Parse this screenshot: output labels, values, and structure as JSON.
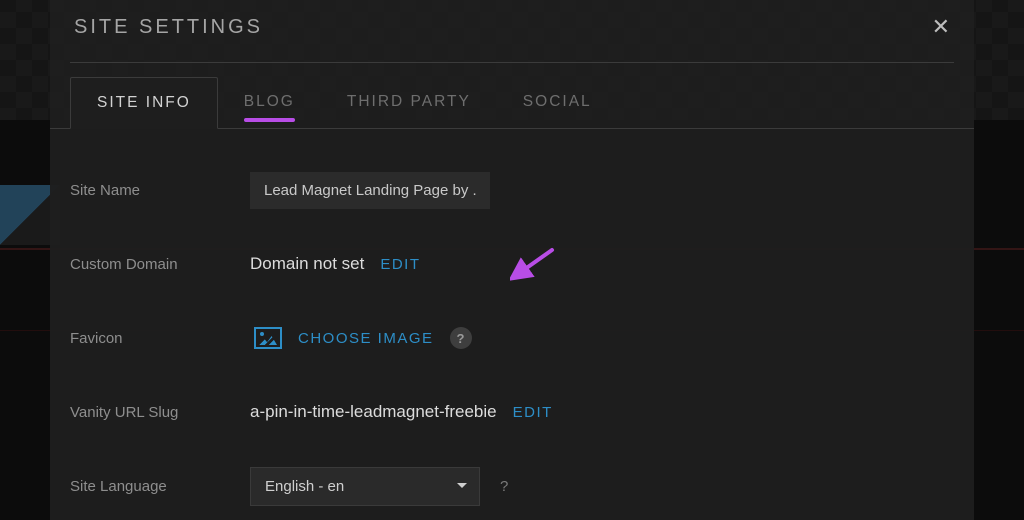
{
  "modal": {
    "title": "SITE SETTINGS"
  },
  "tabs": [
    {
      "label": "SITE INFO",
      "active": true
    },
    {
      "label": "BLOG",
      "active": false,
      "underline": true
    },
    {
      "label": "THIRD PARTY",
      "active": false
    },
    {
      "label": "SOCIAL",
      "active": false
    }
  ],
  "fields": {
    "site_name": {
      "label": "Site Name",
      "value": "Lead Magnet Landing Page by ."
    },
    "custom_domain": {
      "label": "Custom Domain",
      "status": "Domain not set",
      "edit": "EDIT"
    },
    "favicon": {
      "label": "Favicon",
      "choose": "CHOOSE IMAGE",
      "help": "?"
    },
    "vanity": {
      "label": "Vanity URL Slug",
      "value": "a-pin-in-time-leadmagnet-freebie",
      "edit": "EDIT"
    },
    "language": {
      "label": "Site Language",
      "selected": "English - en",
      "help": "?"
    }
  },
  "colors": {
    "accent_link": "#2d8ec7",
    "annotation": "#b84de6"
  }
}
